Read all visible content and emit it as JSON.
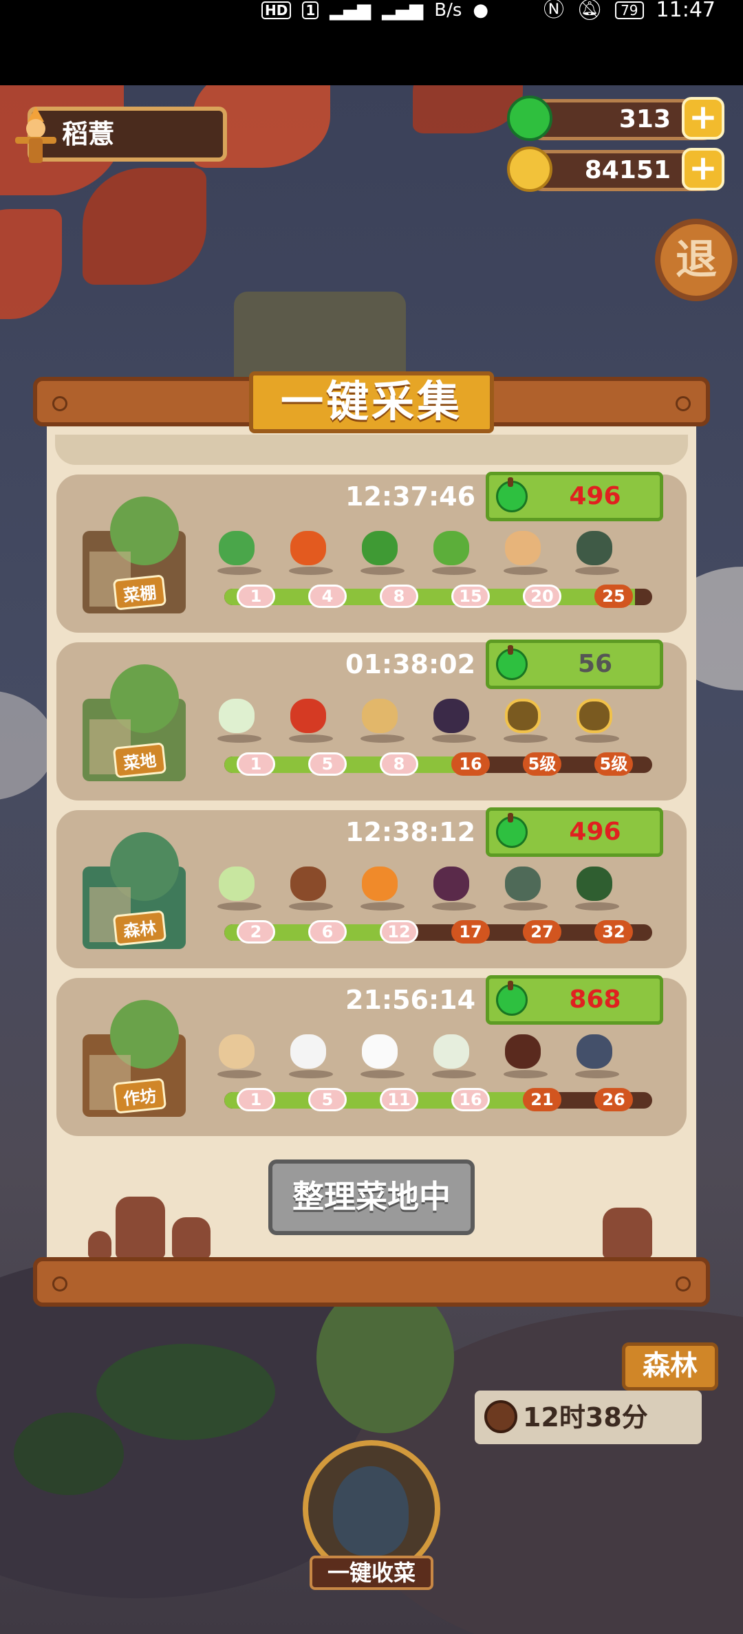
{
  "status_bar": {
    "left_icons": [
      "HD",
      "1",
      "4G",
      "4G",
      "B/s"
    ],
    "battery": "79",
    "time": "11:47"
  },
  "player": {
    "name": "稻薏"
  },
  "resources": {
    "jade": "313",
    "coins": "84151",
    "plus_label": "+"
  },
  "exit_button": {
    "label": "退"
  },
  "panel": {
    "title": "一键采集"
  },
  "rows": [
    {
      "badge": "菜棚",
      "timer": "12:37:46",
      "reward": "496",
      "reward_color": "#e02020",
      "items": [
        "bok-choy-icon",
        "tomato-icon",
        "green-pepper-icon",
        "zucchini-icon",
        "bento-box-icon",
        "radish-icon"
      ],
      "levels": [
        "1",
        "4",
        "8",
        "15",
        "20",
        "25"
      ],
      "progress": 0.96,
      "locked_from": 5
    },
    {
      "badge": "菜地",
      "timer": "01:38:02",
      "reward": "56",
      "reward_color": "#555555",
      "items": [
        "scallion-icon",
        "red-chili-icon",
        "potato-icon",
        "eggplant-icon",
        "lock-icon",
        "lock-icon"
      ],
      "levels": [
        "1",
        "5",
        "8",
        "16",
        "5级",
        "5级"
      ],
      "progress": 0.58,
      "locked_from": 3
    },
    {
      "badge": "森林",
      "timer": "12:38:12",
      "reward": "496",
      "reward_color": "#e02020",
      "items": [
        "cabbage-icon",
        "mushroom-icon",
        "carrot-icon",
        "purple-onion-icon",
        "stone-icon",
        "herb-icon"
      ],
      "levels": [
        "2",
        "6",
        "12",
        "17",
        "27",
        "32"
      ],
      "progress": 0.42,
      "locked_from": 3
    },
    {
      "badge": "作坊",
      "timer": "21:56:14",
      "reward": "868",
      "reward_color": "#e02020",
      "items": [
        "flour-sack-icon",
        "rice-bowl-icon",
        "tofu-icon",
        "dumpling-icon",
        "clay-jar-icon",
        "sauce-boat-icon"
      ],
      "levels": [
        "1",
        "5",
        "11",
        "16",
        "21",
        "26"
      ],
      "progress": 0.73,
      "locked_from": 4
    }
  ],
  "organize_button": {
    "label": "整理菜地中"
  },
  "bottom": {
    "forest_tag": "森林",
    "timer_tag": "12时38分",
    "harvest_label": "一键收菜"
  },
  "colors": {
    "accent_green": "#8cc640",
    "reward_red": "#e02020",
    "wood": "#b0612c",
    "paper": "#efe1c9"
  }
}
